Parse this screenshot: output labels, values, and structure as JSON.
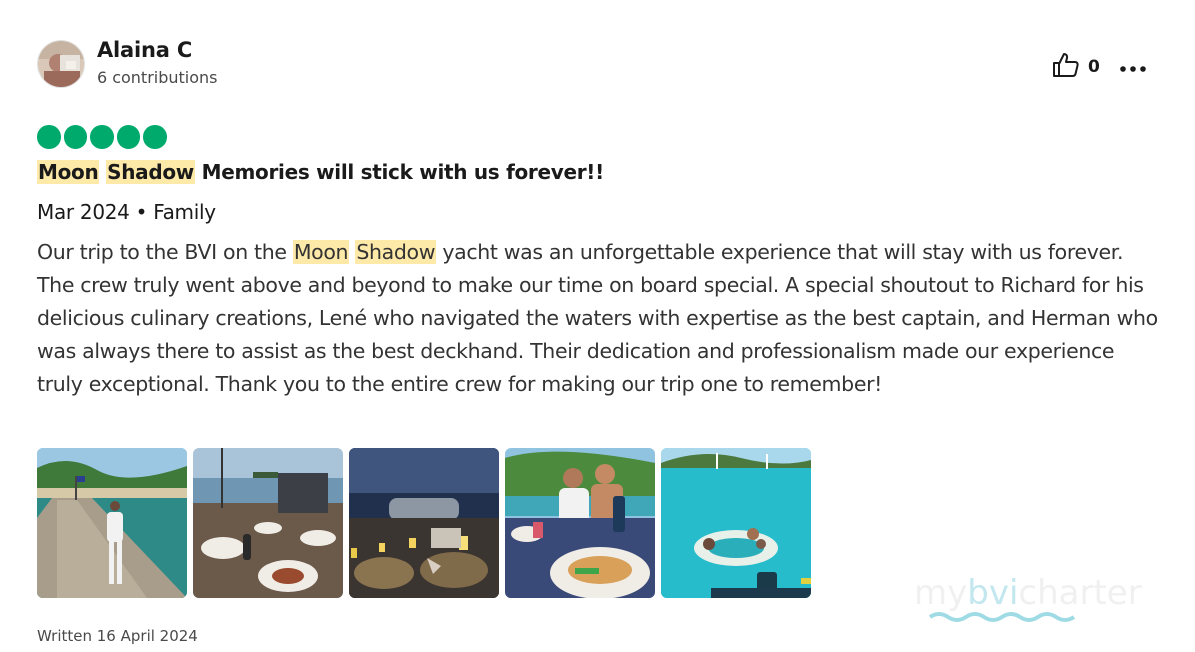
{
  "review": {
    "author": {
      "name": "Alaina C",
      "contributions_count": "6",
      "contributions_label": "contributions"
    },
    "helpful": {
      "count": "0",
      "icon": "thumbs-up-icon"
    },
    "more_icon": "more-options-icon",
    "rating": {
      "value": 5,
      "max": 5,
      "color": "#00aa6c"
    },
    "title": {
      "highlight_1": "Moon",
      "highlight_2": "Shadow",
      "rest": " Memories will stick with us forever!!"
    },
    "trip": {
      "date": "Mar 2024",
      "separator": " • ",
      "type": "Family"
    },
    "body": {
      "before": "Our trip to the BVI on the ",
      "highlight_1": "Moon",
      "highlight_2": "Shadow",
      "after": " yacht was an unforgettable experience that will stay with us forever. The crew truly went above and beyond to make our time on board special. A special shoutout to Richard for his delicious culinary creations, Lené who navigated the waters with expertise as the best captain, and Herman who was always there to assist as the best deckhand. Their dedication and professionalism made our experience truly exceptional. Thank you to the entire crew for making our trip one to remember!"
    },
    "photos_count": 5,
    "written": "Written 16 April 2024",
    "highlight_color": "#fde9a8"
  },
  "watermark": {
    "text": "mybvicharter"
  }
}
